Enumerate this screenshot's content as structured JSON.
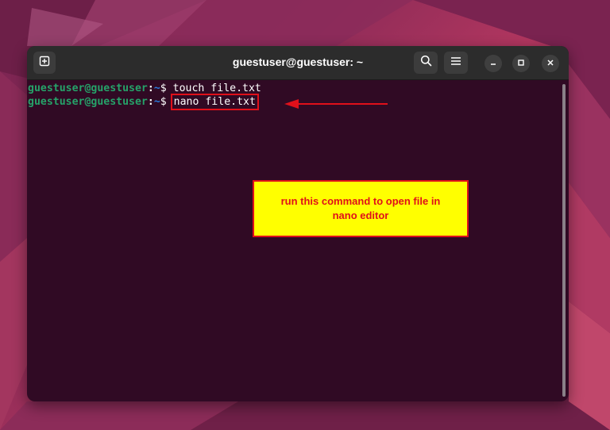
{
  "window": {
    "title": "guestuser@guestuser: ~"
  },
  "terminal": {
    "lines": [
      {
        "user_host": "guestuser@guestuser",
        "separator": ":",
        "dir": "~",
        "dollar": "$",
        "command": "touch file.txt"
      },
      {
        "user_host": "guestuser@guestuser",
        "separator": ":",
        "dir": "~",
        "dollar": "$",
        "command": "nano file.txt"
      }
    ]
  },
  "annotation": {
    "callout_line1": "run this command to open file in",
    "callout_line2": "nano  editor"
  },
  "icons": {
    "new_tab": "new-tab-icon",
    "search": "search-icon",
    "menu": "hamburger-menu-icon",
    "minimize": "minimize-icon",
    "maximize": "maximize-icon",
    "close": "close-icon"
  },
  "colors": {
    "terminal_bg": "#300a24",
    "prompt_user": "#26a269",
    "prompt_dir": "#2a7bde",
    "annotation_red": "#e0101a",
    "annotation_yellow": "#ffff00"
  }
}
